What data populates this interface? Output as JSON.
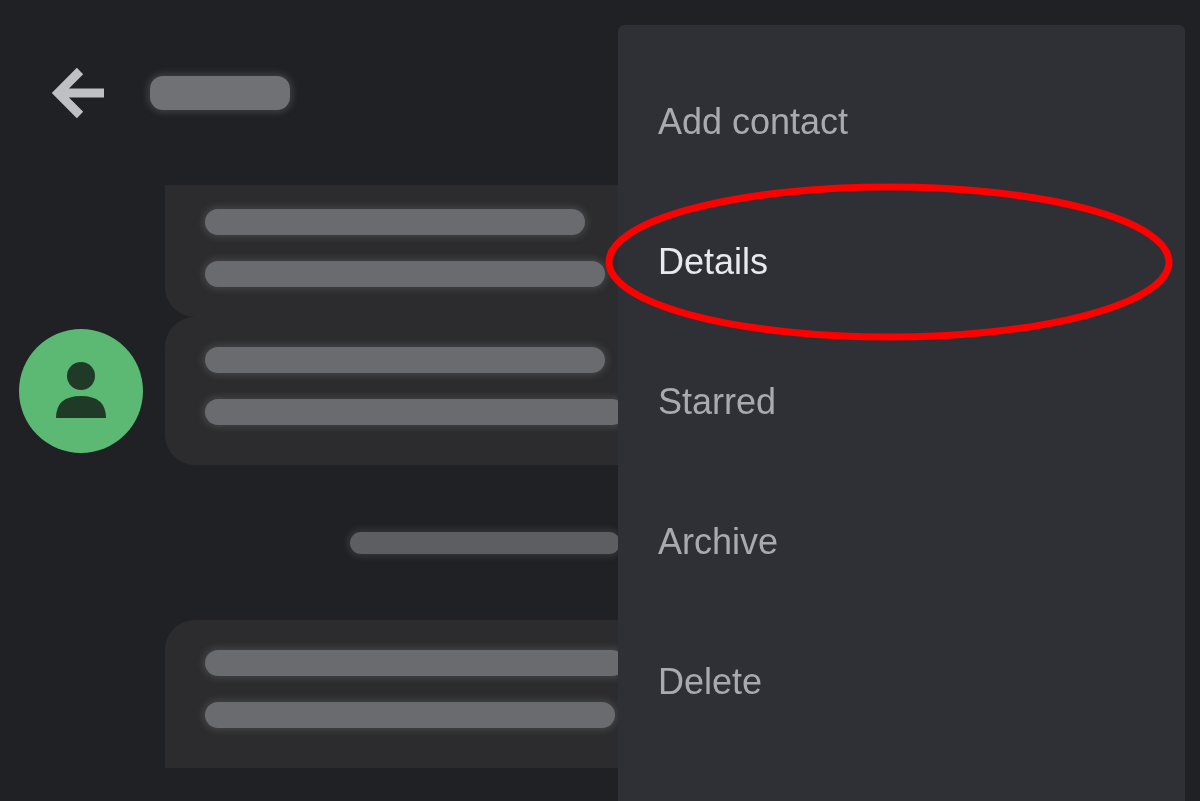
{
  "header": {
    "title": {
      "kind": "redacted"
    }
  },
  "messages": [
    {
      "kind": "bubble",
      "lines": [
        {
          "kind": "redacted"
        },
        {
          "kind": "redacted"
        }
      ]
    },
    {
      "kind": "bubble",
      "lines": [
        {
          "kind": "redacted"
        },
        {
          "kind": "redacted"
        }
      ]
    },
    {
      "kind": "date",
      "text": {
        "kind": "redacted"
      }
    },
    {
      "kind": "bubble",
      "lines": [
        {
          "kind": "redacted"
        },
        {
          "kind": "redacted"
        }
      ]
    }
  ],
  "menu": {
    "items": [
      {
        "label": "Add contact",
        "blurred": true,
        "circled": false
      },
      {
        "label": "Details",
        "blurred": false,
        "circled": true
      },
      {
        "label": "Starred",
        "blurred": true,
        "circled": false
      },
      {
        "label": "Archive",
        "blurred": true,
        "circled": false
      },
      {
        "label": "Delete",
        "blurred": true,
        "circled": false
      }
    ]
  }
}
